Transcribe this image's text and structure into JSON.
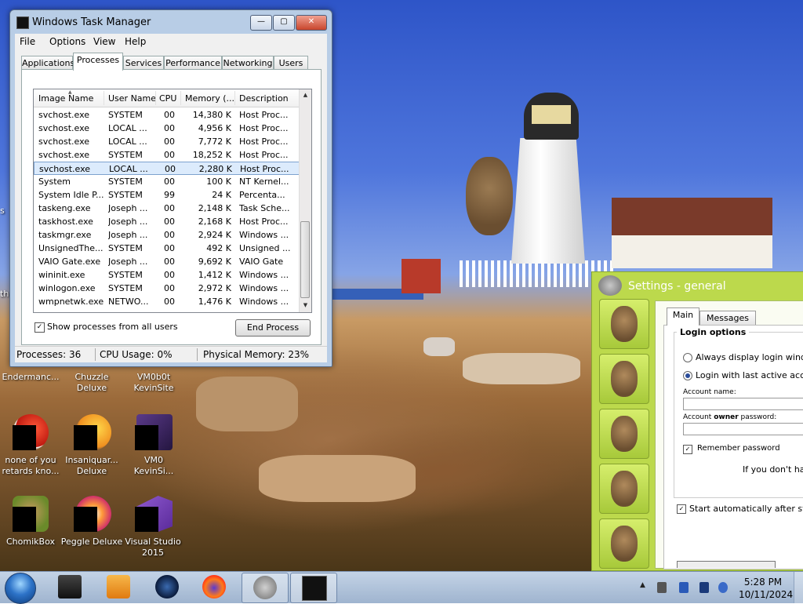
{
  "task_manager": {
    "title": "Windows Task Manager",
    "window_buttons": {
      "min": "—",
      "max": "▢",
      "close": "✕"
    },
    "menu": [
      "File",
      "Options",
      "View",
      "Help"
    ],
    "tabs": [
      "Applications",
      "Processes",
      "Services",
      "Performance",
      "Networking",
      "Users"
    ],
    "active_tab": "Processes",
    "columns": [
      "Image Name",
      "User Name",
      "CPU",
      "Memory (...",
      "Description"
    ],
    "processes": [
      {
        "name": "svchost.exe",
        "user": "SYSTEM",
        "cpu": "00",
        "mem": "14,380 K",
        "desc": "Host Proc..."
      },
      {
        "name": "svchost.exe",
        "user": "LOCAL ...",
        "cpu": "00",
        "mem": "4,956 K",
        "desc": "Host Proc..."
      },
      {
        "name": "svchost.exe",
        "user": "LOCAL ...",
        "cpu": "00",
        "mem": "7,772 K",
        "desc": "Host Proc..."
      },
      {
        "name": "svchost.exe",
        "user": "SYSTEM",
        "cpu": "00",
        "mem": "18,252 K",
        "desc": "Host Proc..."
      },
      {
        "name": "svchost.exe",
        "user": "LOCAL ...",
        "cpu": "00",
        "mem": "2,280 K",
        "desc": "Host Proc..."
      },
      {
        "name": "System",
        "user": "SYSTEM",
        "cpu": "00",
        "mem": "100 K",
        "desc": "NT Kernel..."
      },
      {
        "name": "System Idle P...",
        "user": "SYSTEM",
        "cpu": "99",
        "mem": "24 K",
        "desc": "Percenta..."
      },
      {
        "name": "taskeng.exe",
        "user": "Joseph ...",
        "cpu": "00",
        "mem": "2,148 K",
        "desc": "Task Sche..."
      },
      {
        "name": "taskhost.exe",
        "user": "Joseph ...",
        "cpu": "00",
        "mem": "2,168 K",
        "desc": "Host Proc..."
      },
      {
        "name": "taskmgr.exe",
        "user": "Joseph ...",
        "cpu": "00",
        "mem": "2,924 K",
        "desc": "Windows ..."
      },
      {
        "name": "UnsignedThe...",
        "user": "SYSTEM",
        "cpu": "00",
        "mem": "492 K",
        "desc": "Unsigned ..."
      },
      {
        "name": "VAIO Gate.exe",
        "user": "Joseph ...",
        "cpu": "00",
        "mem": "9,692 K",
        "desc": "VAIO Gate"
      },
      {
        "name": "wininit.exe",
        "user": "SYSTEM",
        "cpu": "00",
        "mem": "1,412 K",
        "desc": "Windows ..."
      },
      {
        "name": "winlogon.exe",
        "user": "SYSTEM",
        "cpu": "00",
        "mem": "2,972 K",
        "desc": "Windows ..."
      },
      {
        "name": "wmpnetwk.exe",
        "user": "NETWO...",
        "cpu": "00",
        "mem": "1,476 K",
        "desc": "Windows ..."
      }
    ],
    "selected_row": 4,
    "show_all_label": "Show processes from all users",
    "show_all_checked": "✓",
    "end_process_label": "End Process",
    "status": {
      "processes": "Processes: 36",
      "cpu": "CPU Usage: 0%",
      "memory": "Physical Memory: 23%"
    }
  },
  "desktop_icons": [
    {
      "line1": "Endermanc...",
      "line2": ""
    },
    {
      "line1": "Chuzzle",
      "line2": "Deluxe"
    },
    {
      "line1": "VM0b0t",
      "line2": "KevinSite"
    },
    {
      "line1": "none of you",
      "line2": "retards kno..."
    },
    {
      "line1": "Insaniquar...",
      "line2": "Deluxe"
    },
    {
      "line1": "VM0",
      "line2": "KevinSi..."
    },
    {
      "line1": "ChomikBox",
      "line2": ""
    },
    {
      "line1": "Peggle Deluxe",
      "line2": ""
    },
    {
      "line1": "Visual Studio",
      "line2": "2015"
    }
  ],
  "edge_label": "th",
  "settings": {
    "title": "Settings - general",
    "tabs": [
      "Main",
      "Messages"
    ],
    "group_title": "Login options",
    "option_always": "Always display login window",
    "option_last": "Login with last active accou",
    "account_name_label": "Account name:",
    "owner_password_label_pre": "Account ",
    "owner_password_label_bold": "owner",
    "owner_password_label_post": " password:",
    "remember_label": "Remember password",
    "info_text": "If you don't have",
    "autostart_label": "Start automatically after syster",
    "check_mark": "✓"
  },
  "taskbar": {
    "clock_time": "5:28 PM",
    "clock_date": "10/11/2024",
    "tray_arrow": "▲"
  },
  "colors": {
    "settings_green": "#bcd94c",
    "taskbar": "#b0c4dd",
    "selection": "#dcebfc"
  }
}
